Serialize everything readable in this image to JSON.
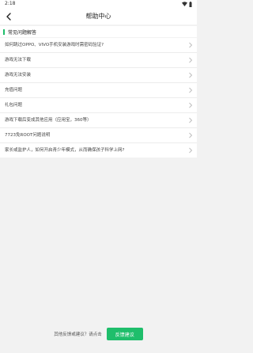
{
  "status_bar": {
    "time": "2:18"
  },
  "nav": {
    "title": "帮助中心"
  },
  "section": {
    "title": "常见问题解答"
  },
  "faq": [
    {
      "label": "如何跳过OPPO、VIVO手机安装游戏时需密码验证?"
    },
    {
      "label": "游戏无法下载"
    },
    {
      "label": "游戏无法安装"
    },
    {
      "label": "充值问题"
    },
    {
      "label": "礼包问题"
    },
    {
      "label": "游戏下载后变成其他应用（应用宝，360等）"
    },
    {
      "label": "7723免ROOT问题说明"
    },
    {
      "label": "家长或监护人，如何开启青少年模式，从而确保孩子科学上网?"
    }
  ],
  "footer": {
    "prompt": "其他反馈或建议？请点击",
    "button_label": "反馈建议"
  },
  "colors": {
    "accent": "#1fbe6b"
  },
  "icons": {
    "back": "back-arrow-icon",
    "chevron": "chevron-right-icon",
    "wifi": "wifi-icon",
    "battery": "battery-icon"
  }
}
